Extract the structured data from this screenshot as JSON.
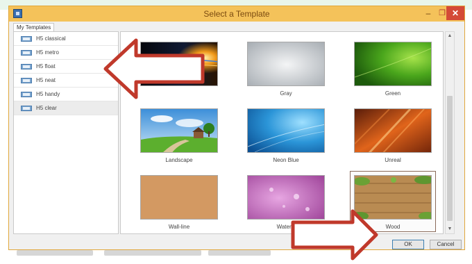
{
  "dialog": {
    "title": "Select a Template",
    "tab_label": "My Templates"
  },
  "window_controls": {
    "minimize_glyph": "–",
    "maximize_glyph": "❐",
    "close_glyph": "✕"
  },
  "templates": [
    {
      "label": "H5 classical"
    },
    {
      "label": "H5 metro"
    },
    {
      "label": "H5 float"
    },
    {
      "label": "H5 neat"
    },
    {
      "label": "H5 handy"
    },
    {
      "label": "H5 clear"
    }
  ],
  "thumbnails": [
    {
      "label": "",
      "icon": "dark-light-streak-image"
    },
    {
      "label": "Gray",
      "icon": "gray-gradient-image"
    },
    {
      "label": "Green",
      "icon": "green-gradient-image"
    },
    {
      "label": "Landscape",
      "icon": "landscape-image"
    },
    {
      "label": "Neon Blue",
      "icon": "neon-blue-image"
    },
    {
      "label": "Unreal",
      "icon": "orange-streak-image"
    },
    {
      "label": "Wall-line",
      "icon": "wall-texture-image"
    },
    {
      "label": "WaterD",
      "icon": "water-drops-image"
    },
    {
      "label": "Wood",
      "icon": "wood-image"
    }
  ],
  "buttons": {
    "ok_label": "OK",
    "cancel_label": "Cancel"
  },
  "colors": {
    "titlebar": "#f4c25a",
    "annotation_arrow": "#c0392b"
  }
}
